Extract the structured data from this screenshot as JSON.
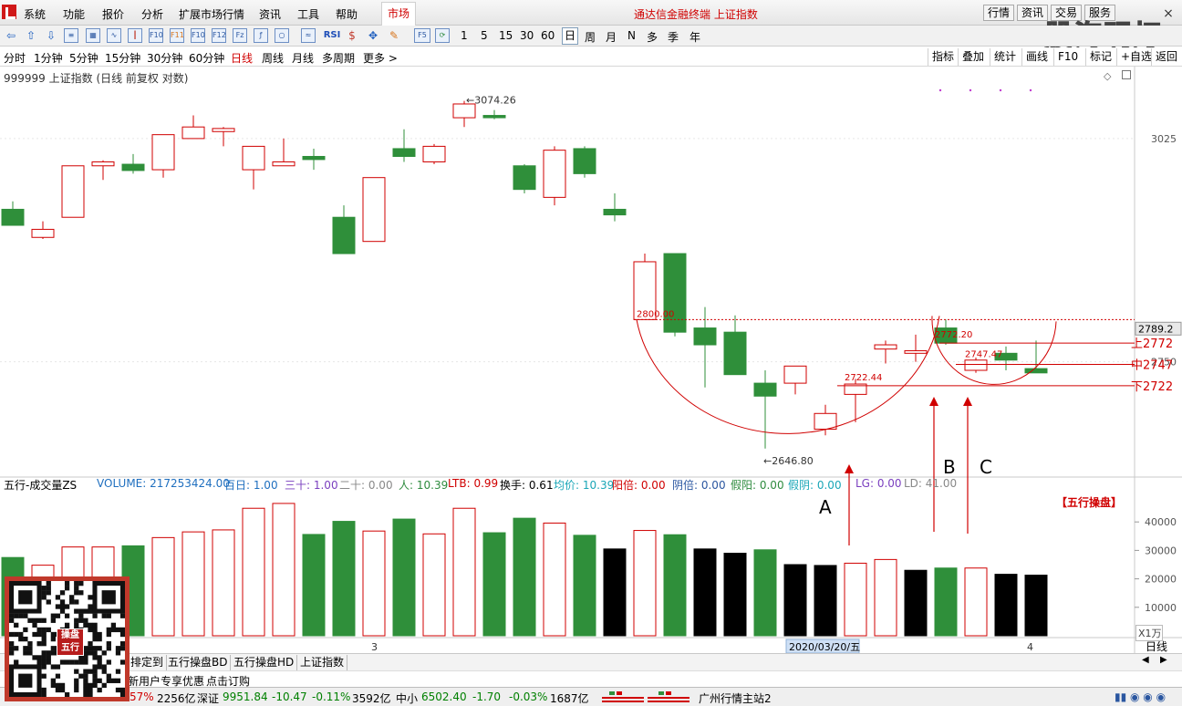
{
  "menu": {
    "items": [
      "系统",
      "功能",
      "报价",
      "分析",
      "扩展市场行情",
      "资讯",
      "工具",
      "帮助"
    ],
    "market_tab": "市场",
    "window_title": "通达信金融终端 上证指数",
    "right_buttons": [
      "行情",
      "资讯",
      "交易",
      "服务"
    ],
    "close": "×",
    "watermark": "股海明灯"
  },
  "toolbar": {
    "indicator_labels": [
      "RSI"
    ],
    "periods": [
      "1",
      "5",
      "15",
      "30",
      "60",
      "日",
      "周",
      "月",
      "N",
      "多",
      "季",
      "年"
    ],
    "active_period": "日",
    "fs_label": "F5"
  },
  "periodbar": {
    "items": [
      "分时",
      "1分钟",
      "5分钟",
      "15分钟",
      "30分钟",
      "60分钟",
      "日线",
      "周线",
      "月线",
      "多周期",
      "更多 >"
    ],
    "active": "日线",
    "right_buttons": [
      "指标",
      "叠加",
      "统计",
      "画线",
      "F10",
      "标记",
      "+自选",
      "返回"
    ]
  },
  "chart": {
    "title": "999999 上证指数 (日线 前复权 对数)",
    "price_labels": {
      "high": "3074.26",
      "low": "2646.80",
      "level_2800": "2800.00",
      "level_2722": "2722.44",
      "level_2772": "2772.20",
      "level_2747": "2747.47",
      "current": "2789.2"
    },
    "axis_price_ticks": [
      {
        "value": 3025,
        "label": "3025"
      },
      {
        "value": 2750,
        "label": "2750"
      }
    ],
    "right_markers": {
      "upper": "上2772",
      "middle": "中2747",
      "lower": "下2722"
    },
    "annotations": {
      "a": "A",
      "b": "B",
      "c": "C"
    },
    "date_label": "2020/03/20/五",
    "x_ticks": [
      "3",
      "4"
    ],
    "volume_axis": [
      {
        "value": 40000,
        "label": "40000"
      },
      {
        "value": 30000,
        "label": "30000"
      },
      {
        "value": 20000,
        "label": "20000"
      },
      {
        "value": 10000,
        "label": "10000"
      }
    ],
    "volume_unit": "X1万",
    "period_tag": "日线",
    "wuxing_tag": "【五行操盘】"
  },
  "chart_data": {
    "type": "candlestick",
    "price_range": [
      2620,
      3100
    ],
    "volume_range": [
      0,
      50000
    ],
    "candles": [
      {
        "o": 2935,
        "h": 2945,
        "l": 2925,
        "c": 2915,
        "v": 27500,
        "dir": "down"
      },
      {
        "o": 2900,
        "h": 2920,
        "l": 2898,
        "c": 2910,
        "v": 24800,
        "dir": "up"
      },
      {
        "o": 2925,
        "h": 2990,
        "l": 2925,
        "c": 2990,
        "v": 31200,
        "dir": "up"
      },
      {
        "o": 2990,
        "h": 2997,
        "l": 2972,
        "c": 2995,
        "v": 31200,
        "dir": "up"
      },
      {
        "o": 2992,
        "h": 3005,
        "l": 2980,
        "c": 2984,
        "v": 31600,
        "dir": "down"
      },
      {
        "o": 2985,
        "h": 3030,
        "l": 2975,
        "c": 3030,
        "v": 34500,
        "dir": "up"
      },
      {
        "o": 3025,
        "h": 3055,
        "l": 3025,
        "c": 3040,
        "v": 36500,
        "dir": "up"
      },
      {
        "o": 3034,
        "h": 3040,
        "l": 3015,
        "c": 3038,
        "v": 37200,
        "dir": "up"
      },
      {
        "o": 3015,
        "h": 3015,
        "l": 2960,
        "c": 2985,
        "v": 44800,
        "dir": "up"
      },
      {
        "o": 2995,
        "h": 3025,
        "l": 2990,
        "c": 2990,
        "v": 46500,
        "dir": "up"
      },
      {
        "o": 3002,
        "h": 3012,
        "l": 2985,
        "c": 2998,
        "v": 35600,
        "dir": "down"
      },
      {
        "o": 2925,
        "h": 2940,
        "l": 2880,
        "c": 2880,
        "v": 40200,
        "dir": "down"
      },
      {
        "o": 2895,
        "h": 2975,
        "l": 2895,
        "c": 2975,
        "v": 36800,
        "dir": "up"
      },
      {
        "o": 3012,
        "h": 3037,
        "l": 2995,
        "c": 3002,
        "v": 41000,
        "dir": "down"
      },
      {
        "o": 2995,
        "h": 3018,
        "l": 2992,
        "c": 3015,
        "v": 35800,
        "dir": "up"
      },
      {
        "o": 3052,
        "h": 3074,
        "l": 3040,
        "c": 3070,
        "v": 44800,
        "dir": "up"
      },
      {
        "o": 3055,
        "h": 3062,
        "l": 3050,
        "c": 3052,
        "v": 36200,
        "dir": "down"
      },
      {
        "o": 2990,
        "h": 2992,
        "l": 2955,
        "c": 2960,
        "v": 41300,
        "dir": "down"
      },
      {
        "o": 2950,
        "h": 3015,
        "l": 2940,
        "c": 3010,
        "v": 39600,
        "dir": "up"
      },
      {
        "o": 3012,
        "h": 3015,
        "l": 2975,
        "c": 2980,
        "v": 35300,
        "dir": "down"
      },
      {
        "o": 2935,
        "h": 2955,
        "l": 2920,
        "c": 2928,
        "v": 30500,
        "dir": "down"
      },
      {
        "o": 2800,
        "h": 2880,
        "l": 2800,
        "c": 2870,
        "v": 37000,
        "dir": "up"
      },
      {
        "o": 2880,
        "h": 2880,
        "l": 2780,
        "c": 2785,
        "v": 35500,
        "dir": "down"
      },
      {
        "o": 2790,
        "h": 2815,
        "l": 2720,
        "c": 2770,
        "v": 30500,
        "dir": "down"
      },
      {
        "o": 2785,
        "h": 2805,
        "l": 2735,
        "c": 2735,
        "v": 29000,
        "dir": "down"
      },
      {
        "o": 2725,
        "h": 2740,
        "l": 2650,
        "c": 2710,
        "v": 30200,
        "dir": "down"
      },
      {
        "o": 2725,
        "h": 2745,
        "l": 2712,
        "c": 2745,
        "v": 25000,
        "dir": "up"
      },
      {
        "o": 2672,
        "h": 2700,
        "l": 2665,
        "c": 2690,
        "v": 24700,
        "dir": "up"
      },
      {
        "o": 2712,
        "h": 2730,
        "l": 2680,
        "c": 2724,
        "v": 25500,
        "dir": "up"
      },
      {
        "o": 2765,
        "h": 2775,
        "l": 2748,
        "c": 2770,
        "v": 26800,
        "dir": "up"
      },
      {
        "o": 2760,
        "h": 2782,
        "l": 2750,
        "c": 2763,
        "v": 23000,
        "dir": "up"
      },
      {
        "o": 2790,
        "h": 2800,
        "l": 2770,
        "c": 2772,
        "v": 23800,
        "dir": "down"
      },
      {
        "o": 2740,
        "h": 2755,
        "l": 2737,
        "c": 2752,
        "v": 23800,
        "dir": "up"
      },
      {
        "o": 2760,
        "h": 2768,
        "l": 2740,
        "c": 2752,
        "v": 21600,
        "dir": "down"
      },
      {
        "o": 2742,
        "h": 2775,
        "l": 2738,
        "c": 2737,
        "v": 21300,
        "dir": "down"
      }
    ],
    "volume_colors": [
      "green",
      "red",
      "red",
      "red",
      "green",
      "red",
      "red",
      "red",
      "red",
      "red",
      "green",
      "green",
      "red",
      "green",
      "red",
      "red",
      "green",
      "green",
      "red",
      "green",
      "black",
      "red",
      "green",
      "black",
      "black",
      "green",
      "black",
      "black",
      "red",
      "red",
      "black",
      "green",
      "red",
      "black",
      "black"
    ]
  },
  "indicator": {
    "name": "五行-成交量ZS",
    "items": [
      {
        "label": "VOLUME: 217253424.00",
        "color": "#1f6fbf"
      },
      {
        "label": "百日: 1.00",
        "color": "#1f6fbf"
      },
      {
        "label": "三十: 1.00",
        "color": "#7a3fbf"
      },
      {
        "label": "二十: 0.00",
        "color": "#888888"
      },
      {
        "label": "人: 10.39",
        "color": "#2e8b3e"
      },
      {
        "label": "LTB: 0.99",
        "color": "#d00000"
      },
      {
        "label": "换手: 0.61",
        "color": "#000000"
      },
      {
        "label": "均价: 10.39",
        "color": "#1aa6b7"
      },
      {
        "label": "阳倍: 0.00",
        "color": "#d00000"
      },
      {
        "label": "阴倍: 0.00",
        "color": "#2a56a0"
      },
      {
        "label": "假阳: 0.00",
        "color": "#2e8b3e"
      },
      {
        "label": "假阴: 0.00",
        "color": "#1aa6b7"
      },
      {
        "label": "LG: 0.00",
        "color": "#7a3fbf"
      },
      {
        "label": "LD: 41.00",
        "color": "#888888"
      }
    ]
  },
  "bottom_tabs": [
    "排定到",
    "五行操盘BD",
    "五行操盘HD",
    "上证指数"
  ],
  "promo": {
    "text1": "新用户专享优惠",
    "text2": "点击订购"
  },
  "statusbar": {
    "seg1": "57%",
    "seg1_amt": "2256亿",
    "sz_name": "深证",
    "sz_value": "9951.84",
    "sz_change": "-10.47",
    "sz_pct": "-0.11%",
    "sz_amt": "3592亿",
    "zx_name": "中小",
    "zx_value": "6502.40",
    "zx_change": "-1.70",
    "zx_pct": "-0.03%",
    "zx_amt": "1687亿",
    "server": "广州行情主站2"
  },
  "qr": {
    "seal_text": "操盘 五行"
  },
  "colors": {
    "up": "#d00000",
    "down": "#2f8f3a",
    "black": "#000000",
    "line": "#d00000",
    "grid": "#e6e6e6"
  }
}
